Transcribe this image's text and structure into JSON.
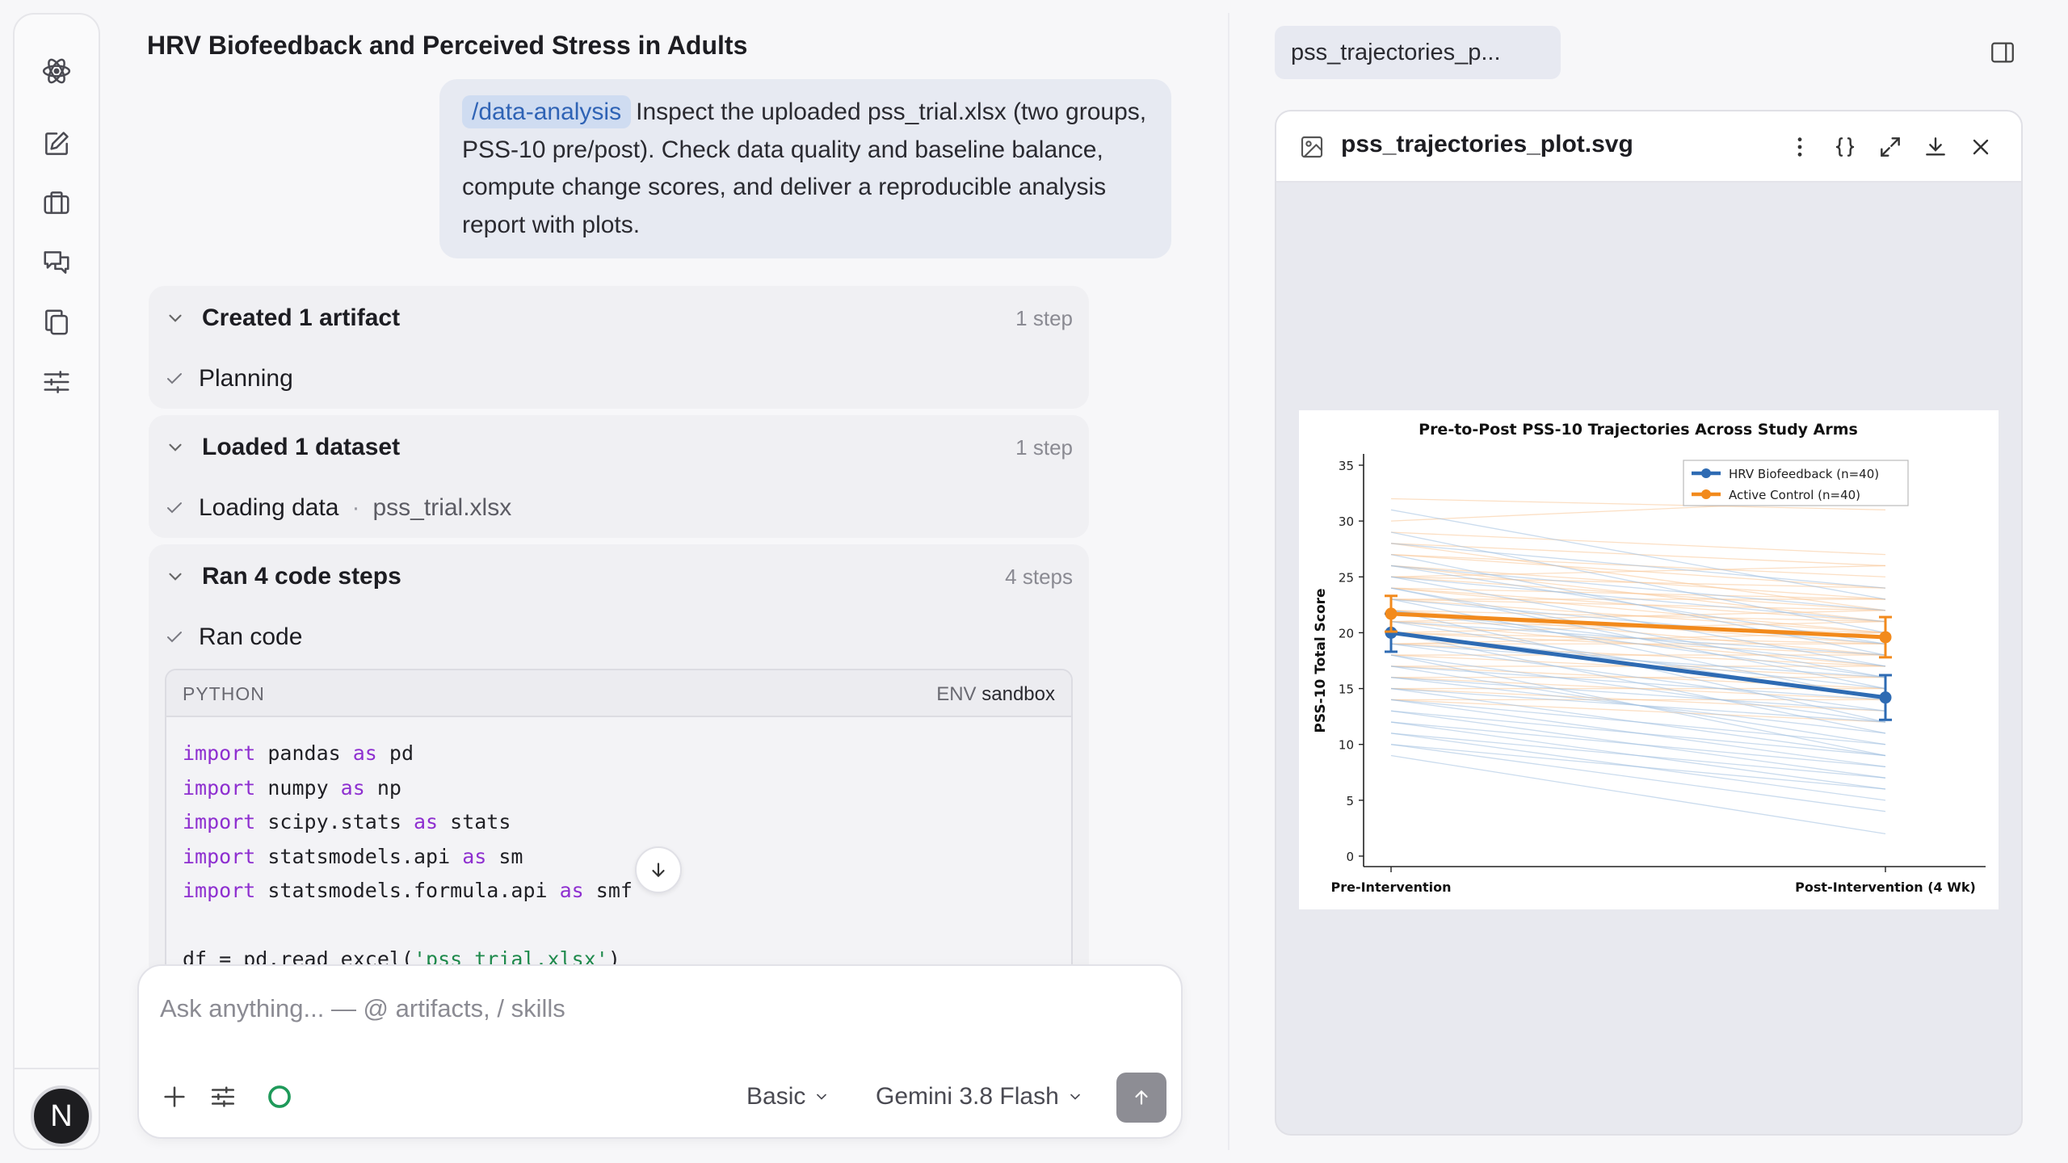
{
  "sidebar": {
    "items": [
      {
        "name": "atom-logo-icon"
      },
      {
        "name": "new-chat-icon"
      },
      {
        "name": "briefcase-icon"
      },
      {
        "name": "chats-icon"
      },
      {
        "name": "copy-icon"
      },
      {
        "name": "sliders-icon"
      }
    ],
    "avatar": "N"
  },
  "chat": {
    "title": "HRV Biofeedback and Perceived Stress in Adults",
    "user_message": {
      "skill": "/data-analysis",
      "text": "Inspect the uploaded pss_trial.xlsx (two groups, PSS-10 pre/post). Check data quality and baseline balance, compute change scores, and deliver a reproducible analysis report with plots."
    },
    "steps": [
      {
        "header": "Created 1 artifact",
        "count": "1 step",
        "item": "Planning",
        "detail": ""
      },
      {
        "header": "Loaded 1 dataset",
        "count": "1 step",
        "item": "Loading data",
        "detail": "pss_trial.xlsx"
      },
      {
        "header": "Ran 4 code steps",
        "count": "4 steps",
        "item": "Ran code",
        "detail": ""
      }
    ],
    "code": {
      "language": "PYTHON",
      "env_label": "ENV",
      "env_value": "sandbox",
      "lines": [
        [
          {
            "k": "kw",
            "t": "import"
          },
          {
            "k": "",
            "t": " pandas "
          },
          {
            "k": "kw",
            "t": "as"
          },
          {
            "k": "",
            "t": " pd"
          }
        ],
        [
          {
            "k": "kw",
            "t": "import"
          },
          {
            "k": "",
            "t": " numpy "
          },
          {
            "k": "kw",
            "t": "as"
          },
          {
            "k": "",
            "t": " np"
          }
        ],
        [
          {
            "k": "kw",
            "t": "import"
          },
          {
            "k": "",
            "t": " scipy.stats "
          },
          {
            "k": "kw",
            "t": "as"
          },
          {
            "k": "",
            "t": " stats"
          }
        ],
        [
          {
            "k": "kw",
            "t": "import"
          },
          {
            "k": "",
            "t": " statsmodels.api "
          },
          {
            "k": "kw",
            "t": "as"
          },
          {
            "k": "",
            "t": " sm"
          }
        ],
        [
          {
            "k": "kw",
            "t": "import"
          },
          {
            "k": "",
            "t": " statsmodels.formula.api "
          },
          {
            "k": "kw",
            "t": "as"
          },
          {
            "k": "",
            "t": " smf"
          }
        ],
        [],
        [
          {
            "k": "",
            "t": "df = pd.read_excel("
          },
          {
            "k": "str",
            "t": "'pss_trial.xlsx'"
          },
          {
            "k": "",
            "t": ")"
          }
        ]
      ]
    }
  },
  "composer": {
    "placeholder": "Ask anything... — @ artifacts, / skills",
    "mode": "Basic",
    "model": "Gemini 3.8 Flash"
  },
  "artifact": {
    "tab_label": "pss_trajectories_p...",
    "file_name": "pss_trajectories_plot.svg",
    "actions": [
      "more-icon",
      "code-view-icon",
      "expand-icon",
      "download-icon",
      "close-icon"
    ]
  },
  "chart_data": {
    "type": "line",
    "title": "Pre-to-Post PSS-10 Trajectories Across Study Arms",
    "xlabel": "",
    "ylabel": "PSS-10 Total Score",
    "categories": [
      "Pre-Intervention",
      "Post-Intervention (4 Wk)"
    ],
    "ylim": [
      0,
      37
    ],
    "yticks": [
      0,
      5,
      10,
      15,
      20,
      25,
      30,
      35
    ],
    "legend_position": "top-right",
    "grid": false,
    "series": [
      {
        "name": "HRV Biofeedback (n=40)",
        "color": "#2e6bb3",
        "values": [
          20.0,
          14.2
        ],
        "error": [
          1.7,
          2.0
        ]
      },
      {
        "name": "Active Control (n=40)",
        "color": "#f28a1c",
        "values": [
          21.7,
          19.6
        ],
        "error": [
          1.6,
          1.8
        ]
      }
    ],
    "individual_trajectories": {
      "hrv_color": "#9fbfe0",
      "control_color": "#f9c594",
      "hrv": [
        [
          31,
          23
        ],
        [
          29,
          20
        ],
        [
          28,
          24
        ],
        [
          27,
          18
        ],
        [
          26,
          22
        ],
        [
          25,
          17
        ],
        [
          25,
          21
        ],
        [
          24,
          15
        ],
        [
          23,
          19
        ],
        [
          23,
          14
        ],
        [
          22,
          16
        ],
        [
          22,
          12
        ],
        [
          21,
          18
        ],
        [
          21,
          14
        ],
        [
          20,
          15
        ],
        [
          20,
          11
        ],
        [
          19,
          13
        ],
        [
          19,
          16
        ],
        [
          18,
          12
        ],
        [
          18,
          9
        ],
        [
          17,
          14
        ],
        [
          17,
          10
        ],
        [
          16,
          11
        ],
        [
          16,
          13
        ],
        [
          15,
          9
        ],
        [
          15,
          12
        ],
        [
          14,
          8
        ],
        [
          14,
          10
        ],
        [
          13,
          7
        ],
        [
          13,
          9
        ],
        [
          12,
          6
        ],
        [
          12,
          8
        ],
        [
          11,
          5
        ],
        [
          11,
          7
        ],
        [
          10,
          6
        ],
        [
          10,
          4
        ],
        [
          9,
          2
        ],
        [
          22,
          17
        ],
        [
          24,
          16
        ],
        [
          26,
          19
        ]
      ],
      "control": [
        [
          32,
          31
        ],
        [
          30,
          32
        ],
        [
          29,
          27
        ],
        [
          28,
          26
        ],
        [
          27,
          25
        ],
        [
          27,
          24
        ],
        [
          26,
          23
        ],
        [
          25,
          24
        ],
        [
          25,
          22
        ],
        [
          24,
          23
        ],
        [
          24,
          21
        ],
        [
          23,
          22
        ],
        [
          23,
          20
        ],
        [
          22,
          21
        ],
        [
          22,
          19
        ],
        [
          21,
          22
        ],
        [
          21,
          20
        ],
        [
          20,
          19
        ],
        [
          20,
          18
        ],
        [
          19,
          20
        ],
        [
          19,
          17
        ],
        [
          18,
          18
        ],
        [
          18,
          16
        ],
        [
          17,
          17
        ],
        [
          17,
          15
        ],
        [
          16,
          16
        ],
        [
          16,
          14
        ],
        [
          15,
          15
        ],
        [
          15,
          13
        ],
        [
          14,
          14
        ],
        [
          14,
          12
        ],
        [
          26,
          21
        ],
        [
          23,
          23
        ],
        [
          24,
          20
        ],
        [
          20,
          21
        ],
        [
          28,
          22
        ],
        [
          22,
          18
        ],
        [
          19,
          19
        ],
        [
          21,
          17
        ],
        [
          25,
          26
        ]
      ]
    }
  }
}
